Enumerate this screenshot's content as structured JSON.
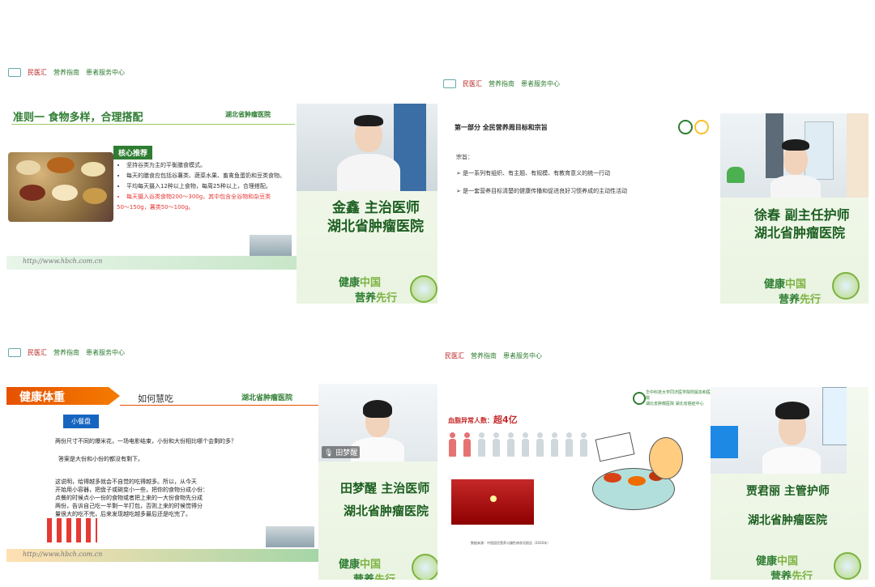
{
  "logos": {
    "a": "民医汇",
    "b": "营养指南",
    "c": "患者服务中心"
  },
  "slogan": {
    "part1": "健康",
    "part2": "中国",
    "part3": "营养",
    "part4": "先行"
  },
  "p1": {
    "title": "准则一  食物多样，合理搭配",
    "hospital_logo": "湖北省肿瘤医院",
    "box": "核心推荐",
    "bullets": [
      "坚持谷类为主的平衡膳食模式。",
      "每天的膳食应包括谷薯类、蔬菜水果、畜禽鱼蛋奶和豆类食物。",
      "平均每天摄入12种以上食物，每周25种以上，合理搭配。"
    ],
    "red_bullet": "每天摄入谷类食物200～300g，其中包含全谷物和杂豆类",
    "red_line2": "50～150g，薯类50～100g。",
    "url": "http://www.hbch.com.cn",
    "speaker_name": "金鑫 主治医师",
    "speaker_org": "湖北省肿瘤医院"
  },
  "p2": {
    "title": "第一部分 全民营养周目标和宗旨",
    "label": "宗旨：",
    "bullets": [
      "是一系列有组织、有主题、有规模、有教育意义的统一行动",
      "是一套营养目标清楚的健康传播和促进良好习惯养成的主动性活动"
    ],
    "speaker_name": "徐春 副主任护师",
    "speaker_org": "湖北省肿瘤医院"
  },
  "p3": {
    "banner": "健康体重",
    "subtitle": "如何慧吃",
    "hospital_logo": "湖北省肿瘤医院",
    "box": "小餐盘",
    "q": "两份尺寸不同的爆米花，一场电影结束，小份和大份相比哪个会剩的多？",
    "a": "答案是大份和小份的都没有剩下。",
    "p_lines": [
      "这说明，给得越多就会不自觉的吃得越多。所以，从今天",
      "开始用小容器，把盘子或碗变小一些，把你的食物分成小份：",
      "点餐的时候点小一份的食物或者把上来的一大份食物先分成",
      "两份，告诉自己吃一半剩一半打包，否则上来的时候觉得分",
      "量很大的吃不完，后来发现越吃越多最后还是吃完了。"
    ],
    "url": "http://www.hbch.com.cn",
    "video_label": "田梦醒",
    "speaker_name": "田梦醒 主治医师",
    "speaker_org": "湖北省肿瘤医院"
  },
  "p4": {
    "header_line1": "华中科技大学同济医学院附属协和医院",
    "header_line2": "湖北省肿瘤医院  湖北省癌症中心",
    "stat_label": "血脂异常人数：",
    "stat_value": "超4亿",
    "footer": "数据来源：中国居民营养与慢性病状况报告（2020年）",
    "speaker_name": "贾君丽 主管护师",
    "speaker_org": "湖北省肿瘤医院"
  }
}
